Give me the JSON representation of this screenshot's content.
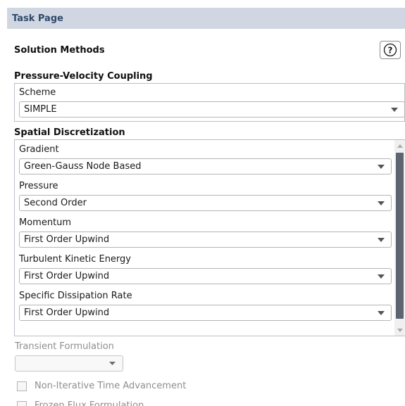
{
  "task_page": {
    "title": "Task Page"
  },
  "solution_methods": {
    "heading": "Solution Methods",
    "help_icon": "help-circle-icon",
    "pressure_velocity_coupling": {
      "heading": "Pressure-Velocity Coupling",
      "scheme": {
        "label": "Scheme",
        "value": "SIMPLE"
      }
    },
    "spatial_discretization": {
      "heading": "Spatial Discretization",
      "fields": [
        {
          "label": "Gradient",
          "value": "Green-Gauss Node Based"
        },
        {
          "label": "Pressure",
          "value": "Second Order"
        },
        {
          "label": "Momentum",
          "value": "First Order Upwind"
        },
        {
          "label": "Turbulent Kinetic Energy",
          "value": "First Order Upwind"
        },
        {
          "label": "Specific Dissipation Rate",
          "value": "First Order Upwind"
        }
      ]
    },
    "transient_formulation": {
      "label": "Transient Formulation",
      "value": ""
    },
    "checkboxes": [
      {
        "label": "Non-Iterative Time Advancement",
        "checked": false
      },
      {
        "label": "Frozen Flux Formulation",
        "checked": false
      }
    ]
  },
  "colors": {
    "title_bar_bg": "#d1d7e2",
    "title_text": "#2e4a6b",
    "scrollbar_thumb": "#5e6570",
    "disabled_text": "#8e8e8e"
  }
}
